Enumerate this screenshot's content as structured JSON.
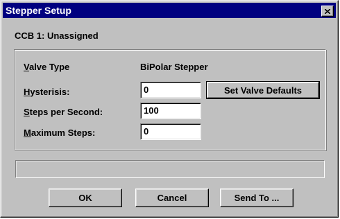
{
  "window": {
    "title": "Stepper Setup"
  },
  "header": {
    "ccb_label": "CCB 1: Unassigned"
  },
  "fields": {
    "valve_type": {
      "label_key": "V",
      "label_rest": "alve Type",
      "value": "BiPolar Stepper"
    },
    "hysteresis": {
      "label_key": "H",
      "label_rest": "ysterisis:",
      "value": "0"
    },
    "steps_per_second": {
      "label_key": "S",
      "label_rest": "teps per Second:",
      "value": "100"
    },
    "maximum_steps": {
      "label_key": "M",
      "label_rest": "aximum Steps:",
      "value": "0"
    }
  },
  "buttons": {
    "set_defaults": "Set Valve Defaults",
    "ok": "OK",
    "cancel": "Cancel",
    "send_to": "Send To ..."
  },
  "status": {
    "text": ""
  },
  "colors": {
    "titlebar": "#000080",
    "face": "#c0c0c0"
  }
}
